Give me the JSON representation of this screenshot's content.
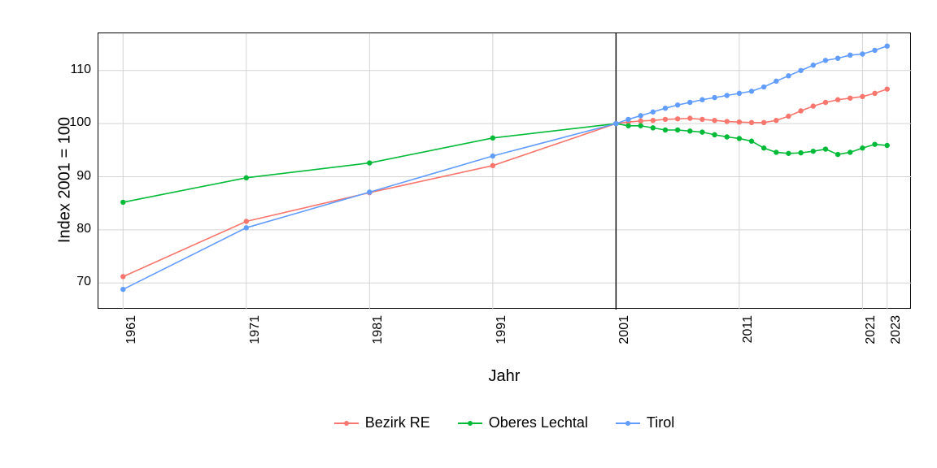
{
  "ylabel": "Index 2001 = 100",
  "xlabel": "Jahr",
  "legend": [
    {
      "label": "Bezirk RE",
      "color": "#F8766D"
    },
    {
      "label": "Oberes Lechtal",
      "color": "#00BA38"
    },
    {
      "label": "Tirol",
      "color": "#619CFF"
    }
  ],
  "x_ticks": [
    1961,
    1971,
    1981,
    1991,
    2001,
    2011,
    2021,
    2023
  ],
  "y_ticks": [
    70,
    80,
    90,
    100,
    110
  ],
  "chart_data": {
    "type": "line",
    "xlabel": "Jahr",
    "ylabel": "Index 2001 = 100",
    "xlim": [
      1959,
      2025
    ],
    "ylim": [
      65,
      117
    ],
    "ref_vline": 2001,
    "series": [
      {
        "name": "Bezirk RE",
        "color": "#F8766D",
        "x": [
          1961,
          1971,
          1981,
          1991,
          2001,
          2002,
          2003,
          2004,
          2005,
          2006,
          2007,
          2008,
          2009,
          2010,
          2011,
          2012,
          2013,
          2014,
          2015,
          2016,
          2017,
          2018,
          2019,
          2020,
          2021,
          2022,
          2023
        ],
        "y": [
          71.2,
          81.6,
          87.0,
          92.1,
          100.0,
          100.3,
          100.5,
          100.6,
          100.8,
          100.9,
          101.0,
          100.8,
          100.6,
          100.4,
          100.3,
          100.2,
          100.2,
          100.6,
          101.4,
          102.4,
          103.3,
          104.0,
          104.5,
          104.8,
          105.1,
          105.7,
          106.5
        ]
      },
      {
        "name": "Oberes Lechtal",
        "color": "#00BA38",
        "x": [
          1961,
          1971,
          1981,
          1991,
          2001,
          2002,
          2003,
          2004,
          2005,
          2006,
          2007,
          2008,
          2009,
          2010,
          2011,
          2012,
          2013,
          2014,
          2015,
          2016,
          2017,
          2018,
          2019,
          2020,
          2021,
          2022,
          2023
        ],
        "y": [
          85.2,
          89.8,
          92.6,
          97.3,
          100.0,
          99.6,
          99.6,
          99.2,
          98.8,
          98.8,
          98.6,
          98.4,
          97.9,
          97.5,
          97.2,
          96.7,
          95.4,
          94.6,
          94.4,
          94.5,
          94.8,
          95.2,
          94.2,
          94.6,
          95.4,
          96.1,
          95.9
        ]
      },
      {
        "name": "Tirol",
        "color": "#619CFF",
        "x": [
          1961,
          1971,
          1981,
          1991,
          2001,
          2002,
          2003,
          2004,
          2005,
          2006,
          2007,
          2008,
          2009,
          2010,
          2011,
          2012,
          2013,
          2014,
          2015,
          2016,
          2017,
          2018,
          2019,
          2020,
          2021,
          2022,
          2023
        ],
        "y": [
          68.8,
          80.4,
          87.1,
          93.9,
          100.0,
          100.8,
          101.5,
          102.2,
          102.9,
          103.5,
          104.0,
          104.5,
          104.9,
          105.3,
          105.7,
          106.1,
          106.9,
          108.0,
          109.0,
          110.0,
          111.0,
          111.9,
          112.3,
          112.9,
          113.1,
          113.8,
          114.6
        ]
      }
    ]
  }
}
